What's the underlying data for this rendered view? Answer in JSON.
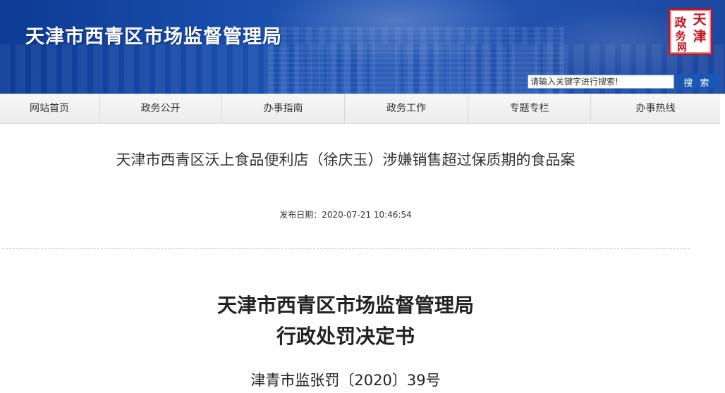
{
  "header": {
    "site_title": "天津市西青区市场监督管理局",
    "seal_text": [
      "政",
      "天",
      "务",
      "津",
      "网"
    ],
    "search": {
      "placeholder": "请输入关键字进行搜索!",
      "button_label": "搜 索"
    },
    "colors": {
      "banner": "#1a4fae",
      "seal": "#c8101a",
      "search_button": "#1a57b5"
    }
  },
  "nav": {
    "items": [
      {
        "label": "网站首页"
      },
      {
        "label": "政务公开"
      },
      {
        "label": "办事指南"
      },
      {
        "label": "政务工作"
      },
      {
        "label": "专题专栏"
      },
      {
        "label": "办事热线"
      }
    ]
  },
  "article": {
    "title": "天津市西青区沃上食品便利店（徐庆玉）涉嫌销售超过保质期的食品案",
    "publish_label": "发布日期：",
    "publish_date": "2020-07-21 10:46:54",
    "doc_org": "天津市西青区市场监督管理局",
    "doc_type": "行政处罚决定书",
    "doc_number": "津青市监张罚〔2020〕39号"
  }
}
